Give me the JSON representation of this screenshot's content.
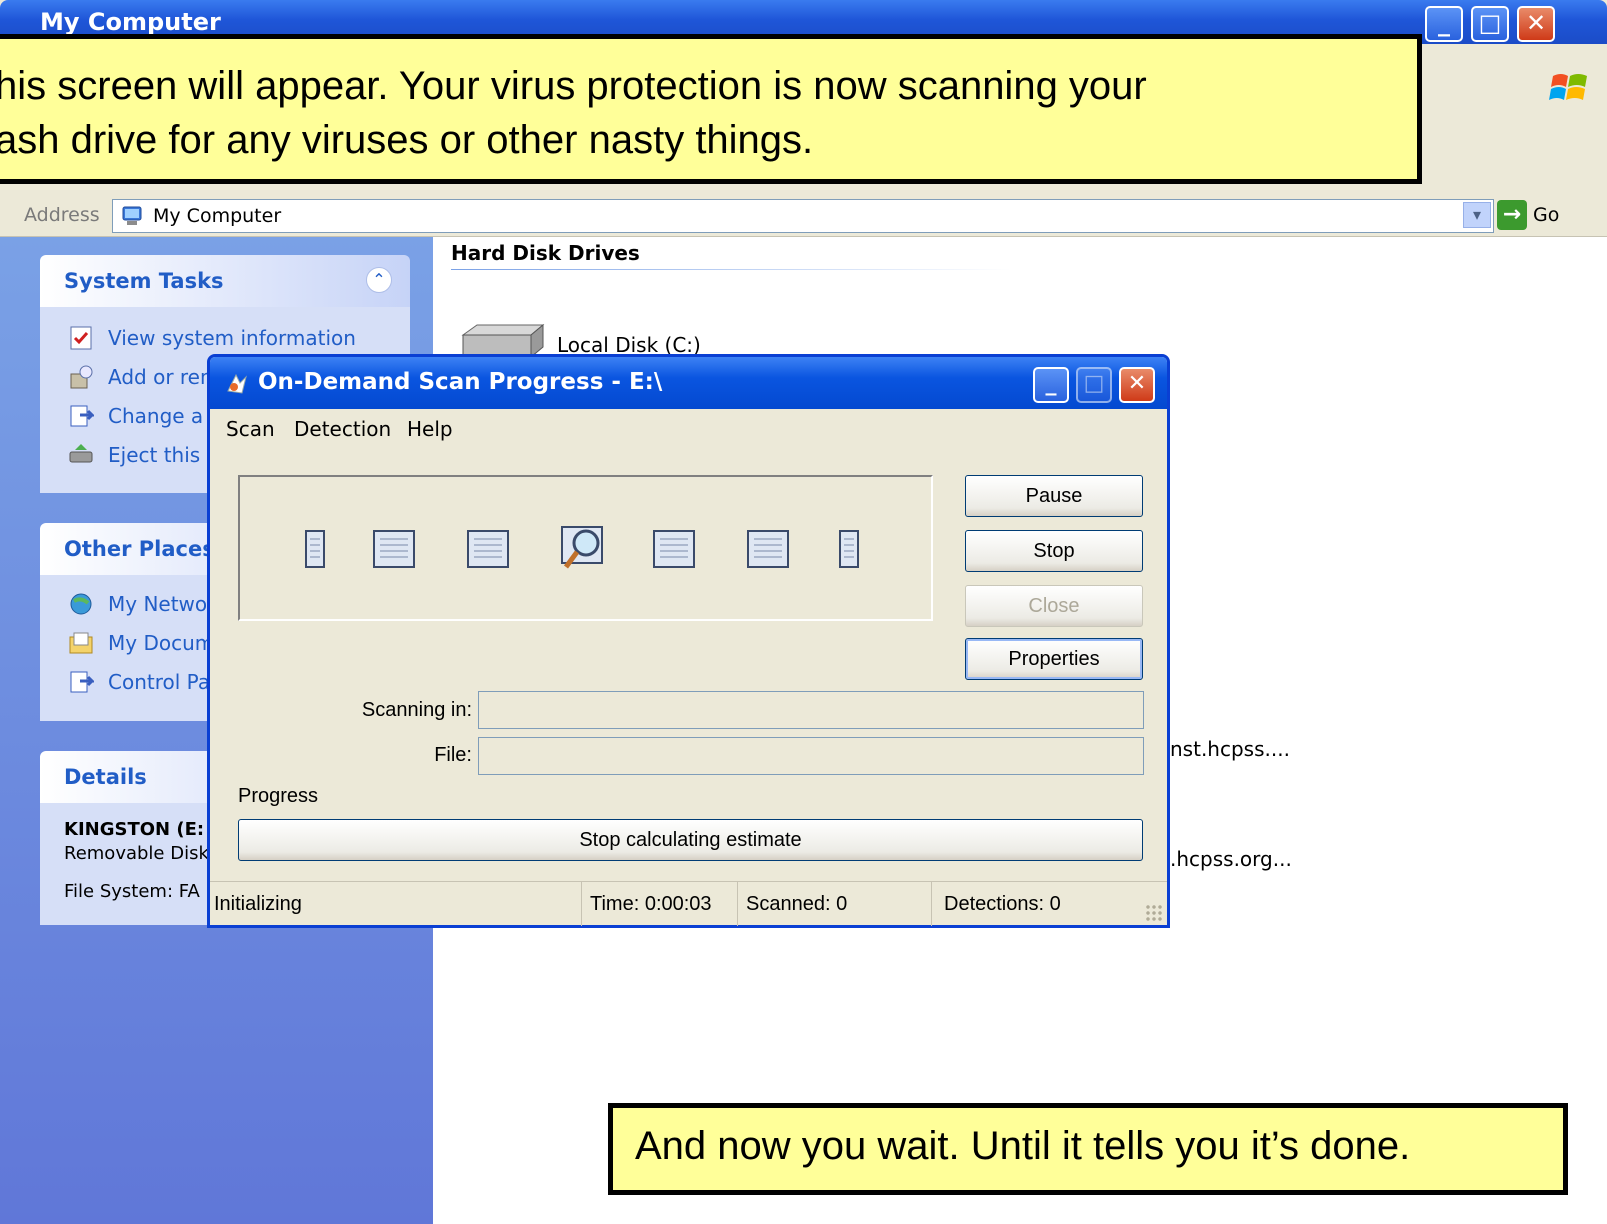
{
  "explorer": {
    "title": "My Computer",
    "address_label": "Address",
    "address_value": "My Computer",
    "go_label": "Go",
    "system_tasks": {
      "title": "System Tasks",
      "items": [
        "View system information",
        "Add or rem",
        "Change a",
        "Eject this d"
      ]
    },
    "other_places": {
      "title": "Other Places",
      "items": [
        "My Networ",
        "My Docum",
        "Control Pa"
      ]
    },
    "details": {
      "title": "Details",
      "name": "KINGSTON (E:",
      "type": "Removable Disk",
      "fs": "File System: FA"
    },
    "content": {
      "section_title": "Hard Disk Drives",
      "drive_label": "Local Disk (C:)",
      "net_item_1": "nst.hcpss....",
      "net_item_2": ".hcpss.org..."
    }
  },
  "dialog": {
    "title": "On-Demand Scan Progress - E:\\",
    "menu": [
      "Scan",
      "Detection",
      "Help"
    ],
    "buttons": {
      "pause": "Pause",
      "stop": "Stop",
      "close": "Close",
      "properties": "Properties"
    },
    "scanning_in_label": "Scanning in:",
    "file_label": "File:",
    "progress_label": "Progress",
    "progress_button": "Stop calculating estimate",
    "status": {
      "state": "Initializing",
      "time": "Time: 0:00:03",
      "scanned": "Scanned: 0",
      "detections": "Detections: 0"
    }
  },
  "callouts": {
    "top": "his screen will appear. Your virus protection is now scanning your\nash drive for any viruses or other nasty things.",
    "bottom": "And now you wait. Until it tells you it’s done."
  },
  "colors": {
    "callout_bg": "#ffff99",
    "xp_blue": "#0a55e0",
    "task_link": "#215dc6"
  }
}
